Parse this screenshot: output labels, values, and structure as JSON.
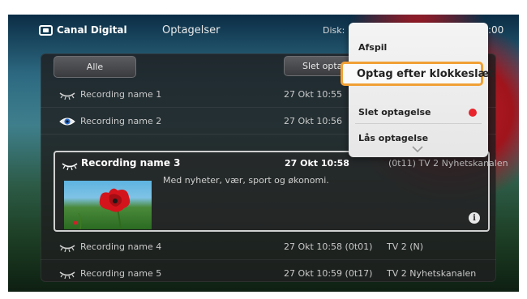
{
  "header": {
    "logo_text": "Canal Digital",
    "title": "Optagelser",
    "disk_label": "Disk:",
    "clock": ":00"
  },
  "toolbar": {
    "all_label": "Alle",
    "delete_label": "Slet optagelse"
  },
  "recordings": [
    {
      "name": "Recording name 1",
      "date": "27 Okt 10:55",
      "channel": "",
      "icon": "eye-closed-icon"
    },
    {
      "name": "Recording name 2",
      "date": "27 Okt 10:56",
      "channel": "",
      "icon": "eye-open-icon"
    },
    {
      "name": "Recording name 3",
      "date": "27 Okt 10:58",
      "channel_partial": "(0t11)   TV 2 Nyhetskanalen",
      "description": "Med nyheter, vær, sport og økonomi.",
      "icon": "eye-closed-icon"
    },
    {
      "name": "Recording name 4",
      "date": "27 Okt 10:58 (0t01)",
      "channel": "TV 2 (N)",
      "icon": "eye-closed-icon"
    },
    {
      "name": "Recording name 5",
      "date": "27 Okt 10:59 (0t17)",
      "channel": "TV 2 Nyhetskanalen",
      "icon": "eye-closed-icon"
    }
  ],
  "context_menu": {
    "items": [
      "Afspil",
      "Optag efter klokkeslæt",
      "Slet optagelse",
      "Lås optagelse"
    ],
    "selected": "Optag efter klokkeslæt"
  },
  "colors": {
    "highlight": "#f0a035",
    "delete_dot": "#e8232b"
  }
}
